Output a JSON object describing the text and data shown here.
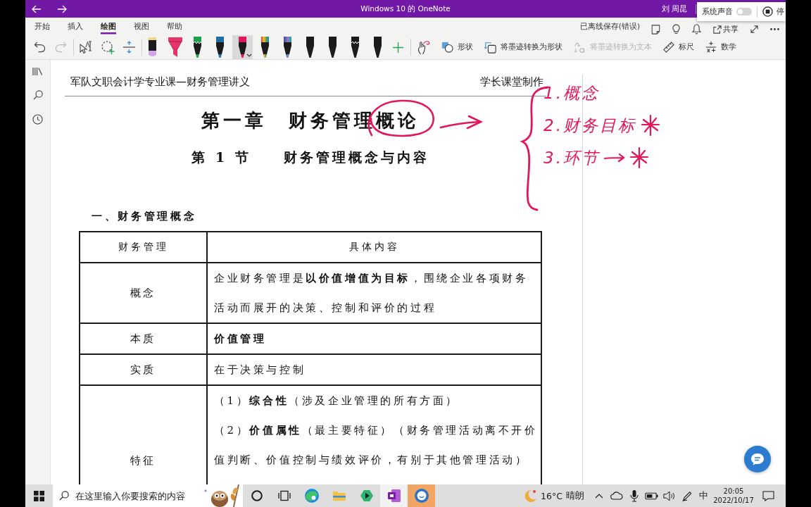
{
  "window": {
    "title": "Windows 10 的 OneNote",
    "user": "刘 周昆"
  },
  "sound_popup": {
    "label": "系统声音",
    "on": false,
    "stop_label": "停"
  },
  "ribbon": {
    "tabs": [
      {
        "label": "开始",
        "selected": false
      },
      {
        "label": "插入",
        "selected": false
      },
      {
        "label": "绘图",
        "selected": true
      },
      {
        "label": "视图",
        "selected": false
      },
      {
        "label": "帮助",
        "selected": false
      }
    ],
    "save_status": "已离线保存(错误)",
    "right_items": [
      {
        "kind": "page"
      },
      {
        "kind": "lightbulb"
      },
      {
        "kind": "bell"
      },
      {
        "kind": "share",
        "label": "共享"
      },
      {
        "kind": "expand"
      },
      {
        "kind": "more"
      }
    ],
    "tools": [
      {
        "kind": "undo",
        "disabled": false
      },
      {
        "kind": "redo",
        "disabled": true
      },
      {
        "kind": "lasso",
        "disabled": false
      },
      {
        "kind": "add_lasso",
        "disabled": false
      },
      {
        "kind": "insert_space",
        "disabled": false
      }
    ],
    "pens": [
      {
        "kind": "marker",
        "color": "#d4a5e6",
        "selected": false
      },
      {
        "kind": "highlighter",
        "color": "#e8336d",
        "selected": false
      },
      {
        "kind": "glitter",
        "color": "#16a34a",
        "selected": false
      },
      {
        "kind": "pen",
        "color": "#1e6fa8",
        "selected": false
      },
      {
        "kind": "pen",
        "color": "#e4165b",
        "selected": true
      },
      {
        "kind": "rainbow",
        "selected": false
      },
      {
        "kind": "galaxy",
        "selected": false
      },
      {
        "kind": "pen",
        "color": "#1a1a1a",
        "selected": false
      },
      {
        "kind": "pen",
        "color": "#1a1a1a",
        "selected": false
      },
      {
        "kind": "glitter",
        "color": "#1a1a1a",
        "selected": false
      },
      {
        "kind": "pen",
        "color": "#1a1a1a",
        "selected": false
      }
    ],
    "actions": [
      {
        "kind": "ink_replay",
        "disabled": false
      },
      {
        "kind": "shapes",
        "label": "形状",
        "disabled": false
      },
      {
        "kind": "ink_to_shape",
        "label": "将墨迹转换为形状",
        "disabled": false
      },
      {
        "kind": "ink_to_text",
        "label": "将墨迹转换为文本",
        "disabled": true
      },
      {
        "kind": "ruler",
        "label": "标尺",
        "disabled": false
      },
      {
        "kind": "math",
        "label": "数学",
        "disabled": false
      }
    ]
  },
  "sidebar": {
    "items": [
      {
        "kind": "notebooks"
      },
      {
        "kind": "search"
      },
      {
        "kind": "recent"
      }
    ]
  },
  "document": {
    "header_left": "军队文职会计学专业课—财务管理讲义",
    "header_right": "学长课堂制作",
    "chapter_title": "第一章　财务管理概论",
    "section_title": "第 1 节　　财务管理概念与内容",
    "heading": "一、财务管理概念",
    "table": {
      "columns": [
        "财务管理",
        "具体内容"
      ],
      "rows": [
        {
          "label": "概念",
          "content": [
            {
              "text": "企业财务管理是**以价值增值为目标**，围绕企业各项财务活动而展开的决策、控制和评价的过程",
              "bold": false
            }
          ]
        },
        {
          "label": "本质",
          "content": [
            {
              "text": "价值管理",
              "bold": true
            }
          ]
        },
        {
          "label": "实质",
          "content": [
            {
              "text": "在于决策与控制",
              "bold": false
            }
          ]
        },
        {
          "label": "特征",
          "content": [
            {
              "text": "（1）**综合性**（涉及企业管理的所有方面）",
              "bold": false
            },
            {
              "text": "（2）**价值属性**（最主要特征）（财务管理活动离不开价值判断、价值控制与绩效评价，有别于其他管理活动）",
              "bold": false
            }
          ]
        }
      ]
    }
  },
  "ink": {
    "notes": [
      {
        "text": "1.概念",
        "arrow": false,
        "star": false
      },
      {
        "text": "2.财务目标",
        "arrow": false,
        "star": true
      },
      {
        "text": "3.环节",
        "arrow": true,
        "star": true
      }
    ]
  },
  "taskbar": {
    "search": {
      "placeholder": "在这里输入你要搜索的内容"
    },
    "apps": [
      {
        "kind": "cortana",
        "active": false,
        "attention": false
      },
      {
        "kind": "task_view",
        "active": false,
        "attention": false
      },
      {
        "kind": "edge",
        "active": false,
        "attention": false
      },
      {
        "kind": "explorer",
        "active": false,
        "attention": false
      },
      {
        "kind": "green_app",
        "active": false,
        "attention": false
      },
      {
        "kind": "onenote",
        "active": true,
        "attention": false
      },
      {
        "kind": "blue_app",
        "active": false,
        "attention": true
      }
    ],
    "weather": {
      "temperature": "16°C",
      "condition": "晴朗"
    },
    "tray": [
      {
        "kind": "chevron"
      },
      {
        "kind": "cloud"
      },
      {
        "kind": "microphone"
      },
      {
        "kind": "battery"
      },
      {
        "kind": "volume"
      },
      {
        "kind": "pen"
      }
    ],
    "ime": "中",
    "time": "20:05",
    "date": "2022/10/17"
  }
}
